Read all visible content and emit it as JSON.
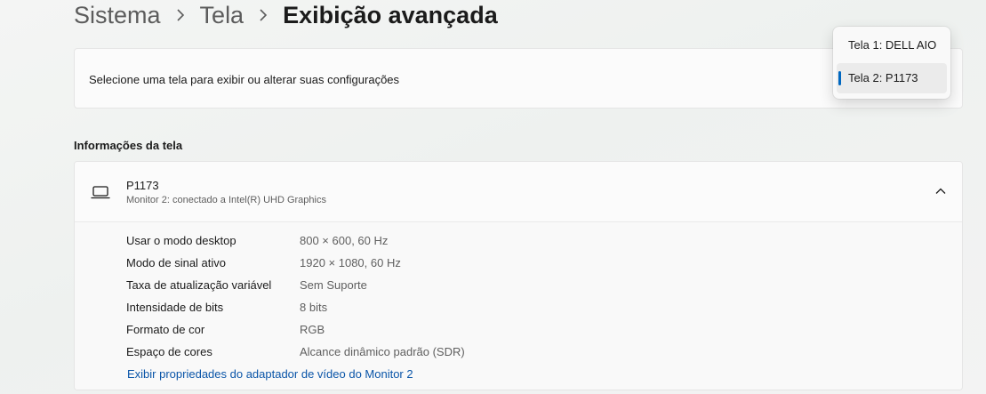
{
  "breadcrumb": {
    "items": [
      "Sistema",
      "Tela"
    ],
    "current": "Exibição avançada"
  },
  "select_display": {
    "label": "Selecione uma tela para exibir ou alterar suas configurações",
    "options": [
      "Tela 1: DELL AIO",
      "Tela 2: P1173"
    ],
    "selected": "Tela 2: P1173"
  },
  "display_info": {
    "section_title": "Informações da tela",
    "name": "P1173",
    "subtitle": "Monitor 2: conectado a Intel(R) UHD Graphics",
    "rows": [
      {
        "key": "Usar o modo desktop",
        "value": "800 × 600, 60 Hz"
      },
      {
        "key": "Modo de sinal ativo",
        "value": "1920 × 1080, 60 Hz"
      },
      {
        "key": "Taxa de atualização variável",
        "value": "Sem Suporte"
      },
      {
        "key": "Intensidade de bits",
        "value": "8 bits"
      },
      {
        "key": "Formato de cor",
        "value": "RGB"
      },
      {
        "key": "Espaço de cores",
        "value": "Alcance dinâmico padrão (SDR)"
      }
    ],
    "link": "Exibir propriedades do adaptador de vídeo do Monitor 2"
  },
  "colors": {
    "accent": "#0067c0",
    "link": "#0a55a8"
  },
  "icons": {
    "breadcrumb_separator": "chevron-right-icon",
    "display": "laptop-icon",
    "expander": "chevron-up-icon"
  }
}
